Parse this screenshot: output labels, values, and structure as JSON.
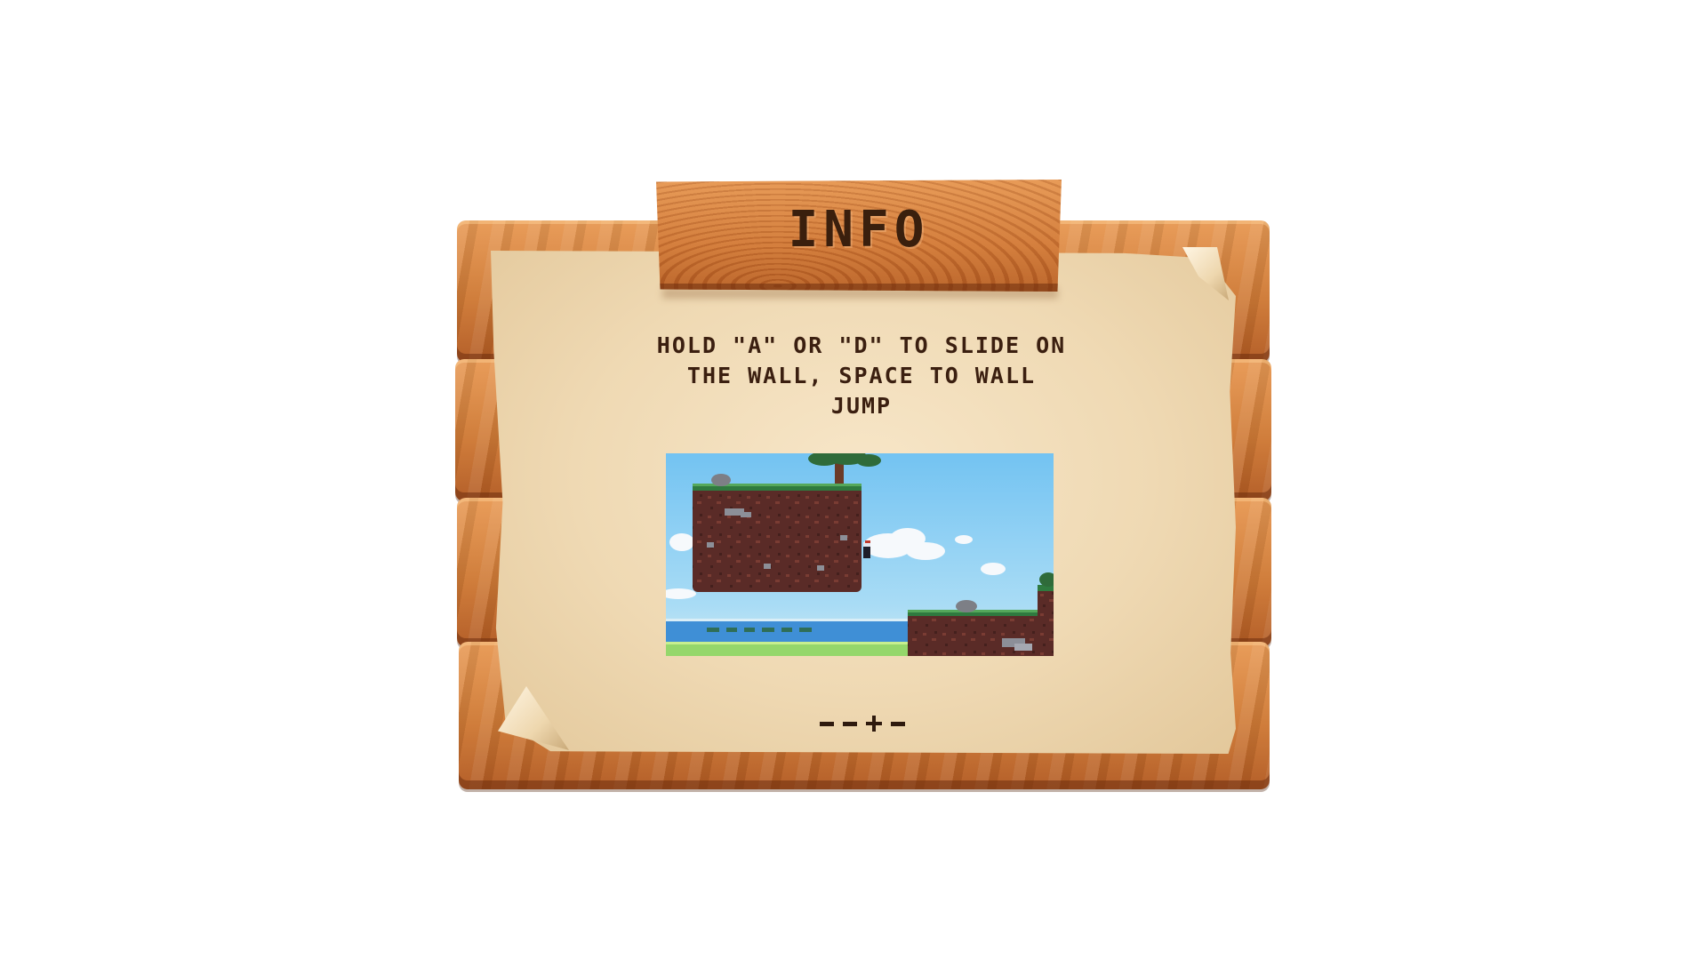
{
  "panel": {
    "title": "INFO",
    "instructions": "HOLD \"A\" OR \"D\" TO SLIDE ON THE WALL, SPACE TO WALL JUMP"
  },
  "preview": {
    "icon": "wall-jump-preview-image"
  },
  "pager": {
    "pages": 4,
    "current_page": 3
  },
  "colors": {
    "wood": "#cf7a36",
    "wood_dark": "#8a3f17",
    "paper": "#f1dcb7",
    "text": "#3b1f10"
  }
}
